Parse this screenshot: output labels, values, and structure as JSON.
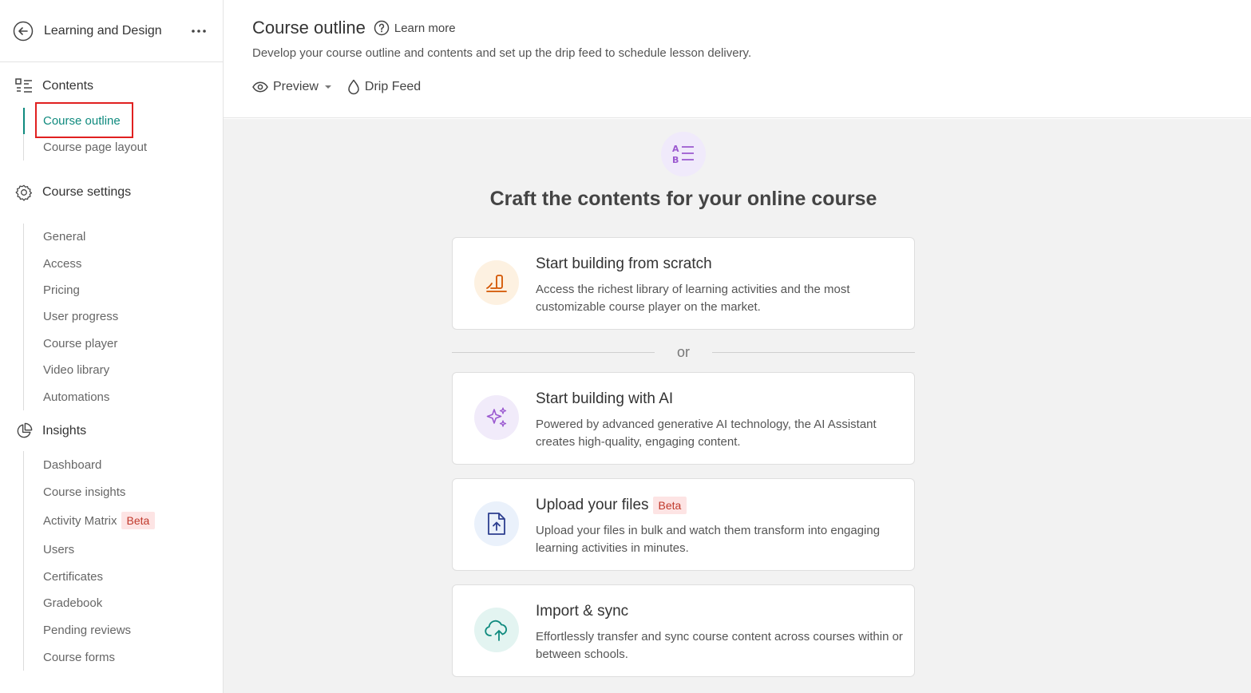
{
  "sidebar": {
    "school_name": "Learning and Design",
    "contents": {
      "title": "Contents",
      "items": [
        {
          "label": "Course outline"
        },
        {
          "label": "Course page layout"
        }
      ]
    },
    "settings": {
      "title": "Course settings",
      "items": [
        {
          "label": "General"
        },
        {
          "label": "Access"
        },
        {
          "label": "Pricing"
        },
        {
          "label": "User progress"
        },
        {
          "label": "Course player"
        },
        {
          "label": "Video library"
        },
        {
          "label": "Automations"
        }
      ]
    },
    "insights": {
      "title": "Insights",
      "items": [
        {
          "label": "Dashboard"
        },
        {
          "label": "Course insights"
        },
        {
          "label": "Activity Matrix",
          "badge": "Beta"
        },
        {
          "label": "Users"
        },
        {
          "label": "Certificates"
        },
        {
          "label": "Gradebook"
        },
        {
          "label": "Pending reviews"
        },
        {
          "label": "Course forms"
        }
      ]
    }
  },
  "header": {
    "title": "Course outline",
    "learn_more": "Learn more",
    "description": "Develop your course outline and contents and set up the drip feed to schedule lesson delivery.",
    "preview": "Preview",
    "drip_feed": "Drip Feed"
  },
  "content": {
    "hero_title": "Craft the contents for your online course",
    "or": "or",
    "cards": [
      {
        "title": "Start building from scratch",
        "description": "Access the richest library of learning activities and the most customizable course player on the market."
      },
      {
        "title": "Start building with AI",
        "description": "Powered by advanced generative AI technology, the AI Assistant creates high-quality, engaging content."
      },
      {
        "title": "Upload your files",
        "badge": "Beta",
        "description": "Upload your files in bulk and watch them transform into engaging learning activities in minutes."
      },
      {
        "title": "Import & sync",
        "description": "Effortlessly transfer and sync course content across courses within or between schools."
      }
    ]
  },
  "colors": {
    "accent": "#0f8a7e",
    "highlight": "#e02020",
    "beta_bg": "#fde4e4",
    "beta_text": "#c0392b"
  }
}
